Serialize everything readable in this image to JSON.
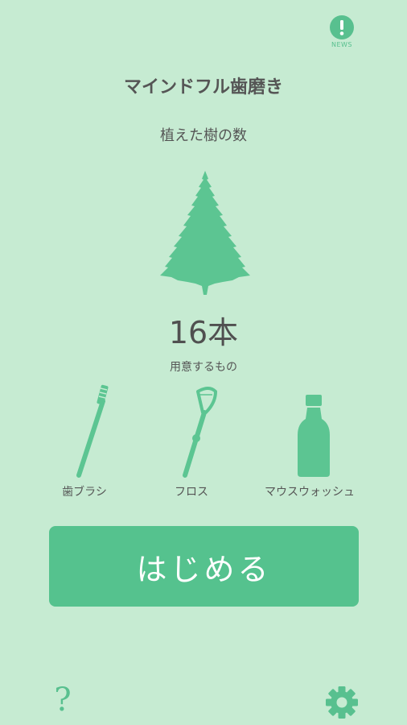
{
  "header": {
    "news_label": "NEWS",
    "title": "マインドフル歯磨き"
  },
  "stats": {
    "trees_label": "植えた樹の数",
    "tree_count": "16本"
  },
  "supplies": {
    "label": "用意するもの",
    "items": [
      {
        "label": "歯ブラシ",
        "icon": "toothbrush-icon"
      },
      {
        "label": "フロス",
        "icon": "floss-icon"
      },
      {
        "label": "マウスウォッシュ",
        "icon": "mouthwash-icon"
      }
    ]
  },
  "actions": {
    "start_label": "はじめる",
    "help_label": "?"
  },
  "colors": {
    "background": "#c6ebd2",
    "accent": "#55c28e",
    "text": "#555555"
  }
}
